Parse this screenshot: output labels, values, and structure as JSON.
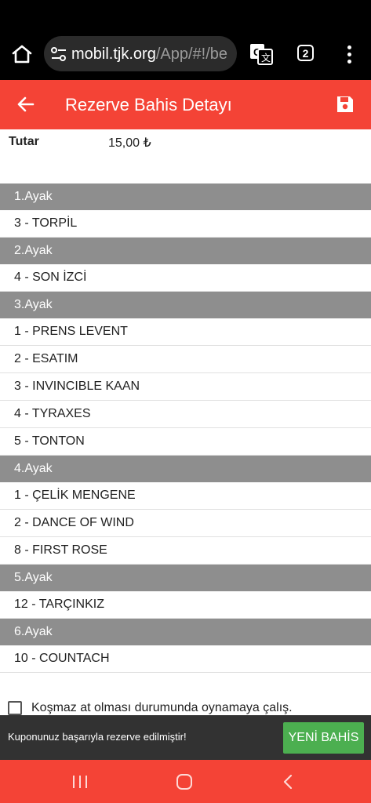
{
  "browser": {
    "url_host": "mobil.tjk.org",
    "url_path": "/App/#!/be",
    "tab_count": "2"
  },
  "header": {
    "title": "Rezerve Bahis Detayı"
  },
  "summary": {
    "amount_label": "Tutar",
    "amount_value": "15,00 ₺"
  },
  "legs": [
    {
      "title": "1.Ayak",
      "horses": [
        "3 - TORPİL"
      ]
    },
    {
      "title": "2.Ayak",
      "horses": [
        "4 - SON İZCİ"
      ]
    },
    {
      "title": "3.Ayak",
      "horses": [
        "1 - PRENS LEVENT",
        "2 - ESATIM",
        "3 - INVINCIBLE KAAN",
        "4 - TYRAXES",
        "5 - TONTON"
      ]
    },
    {
      "title": "4.Ayak",
      "horses": [
        "1 - ÇELİK MENGENE",
        "2 - DANCE OF WIND",
        "8 - FIRST ROSE"
      ]
    },
    {
      "title": "5.Ayak",
      "horses": [
        "12 - TARÇINKIZ"
      ]
    },
    {
      "title": "6.Ayak",
      "horses": [
        "10 - COUNTACH"
      ]
    }
  ],
  "option": {
    "label": "Koşmaz at olması durumunda oynamaya çalış.",
    "checked": false
  },
  "snackbar": {
    "message": "Kuponunuz başarıyla rezerve edilmiştir!",
    "action_label": "YENİ BAHİS"
  },
  "colors": {
    "accent": "#f44336",
    "leg_header": "#8e8e8e",
    "action": "#4caf50",
    "snackbar": "#323232"
  },
  "icons": {
    "home": "home-icon",
    "site_settings": "tune-icon",
    "translate": "translate-icon",
    "tabs": "tabs-icon",
    "menu": "more-vert-icon",
    "back": "arrow-back-icon",
    "save": "save-icon",
    "nav_recents": "recents-icon",
    "nav_home": "nav-home-icon",
    "nav_back": "nav-back-icon"
  }
}
